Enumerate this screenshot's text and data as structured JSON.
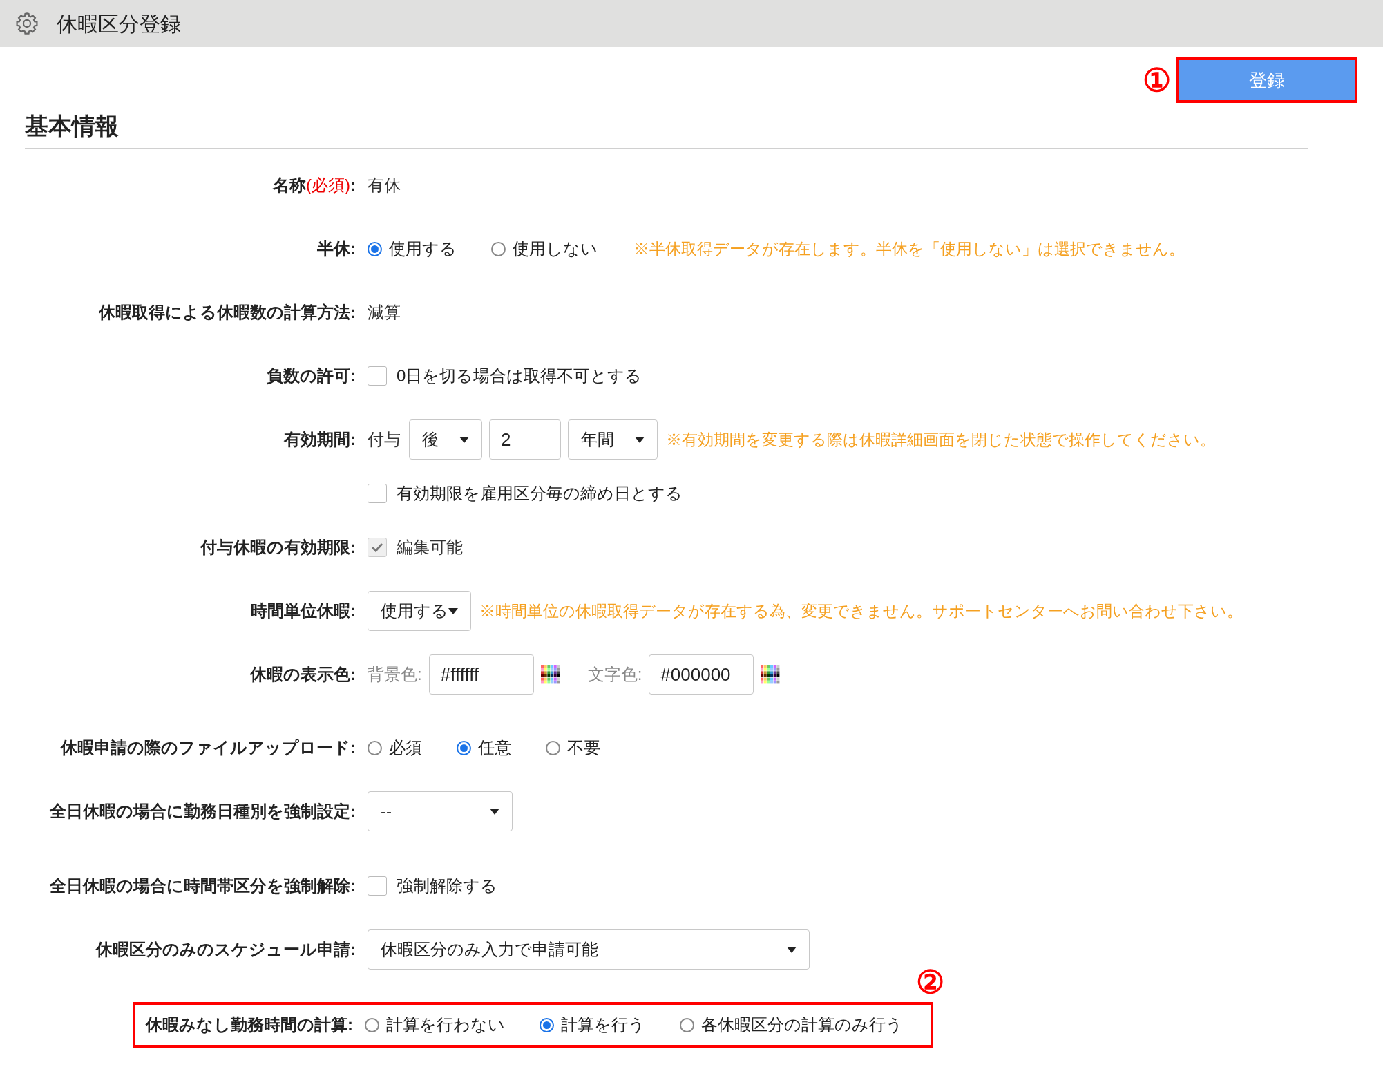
{
  "header": {
    "title": "休暇区分登録"
  },
  "register_button": {
    "label": "登録",
    "annotation": "①"
  },
  "section": {
    "title": "基本情報"
  },
  "rows": [
    {
      "label": "名称",
      "required_note": "(必須)",
      "label_tail": ":",
      "items": [
        {
          "kind": "text",
          "text": "有休"
        }
      ]
    },
    {
      "label": "半休:",
      "items": [
        {
          "kind": "radio",
          "label": "使用する",
          "selected": true
        },
        {
          "kind": "radio",
          "label": "使用しない",
          "selected": false
        },
        {
          "kind": "note",
          "text": "※半休取得データが存在します。半休を「使用しない」は選択できません。"
        }
      ]
    },
    {
      "label": "休暇取得による休暇数の計算方法:",
      "items": [
        {
          "kind": "text",
          "text": "減算"
        }
      ]
    },
    {
      "label": "負数の許可:",
      "items": [
        {
          "kind": "checkbox",
          "label": "0日を切る場合は取得不可とする",
          "checked": false,
          "disabled": false
        }
      ]
    },
    {
      "label": "有効期間:",
      "items": [
        {
          "kind": "text",
          "text": "付与"
        },
        {
          "kind": "select",
          "value": "後"
        },
        {
          "kind": "input",
          "value": "2"
        },
        {
          "kind": "select",
          "value": "年間"
        },
        {
          "kind": "note",
          "text": "※有効期間を変更する際は休暇詳細画面を閉じた状態で操作してください。"
        }
      ]
    },
    {
      "items": [
        {
          "kind": "checkbox",
          "label": "有効期限を雇用区分毎の締め日とする",
          "checked": false,
          "disabled": false
        }
      ]
    },
    {
      "label": "付与休暇の有効期限:",
      "items": [
        {
          "kind": "checkbox",
          "label": "編集可能",
          "checked": true,
          "disabled": true
        }
      ]
    },
    {
      "label": "時間単位休暇:",
      "items": [
        {
          "kind": "select",
          "value": "使用する"
        },
        {
          "kind": "note",
          "text": "※時間単位の休暇取得データが存在する為、変更できません。サポートセンターへお問い合わせ下さい。"
        }
      ]
    },
    {
      "label": "休暇の表示色:",
      "items": [
        {
          "kind": "color",
          "caption": "背景色:",
          "value": "#ffffff"
        },
        {
          "kind": "color",
          "caption": "文字色:",
          "value": "#000000"
        }
      ]
    },
    {
      "label": "休暇申請の際のファイルアップロード:",
      "items": [
        {
          "kind": "radio",
          "label": "必須",
          "selected": false
        },
        {
          "kind": "radio",
          "label": "任意",
          "selected": true
        },
        {
          "kind": "radio",
          "label": "不要",
          "selected": false
        }
      ]
    },
    {
      "label": "全日休暇の場合に勤務日種別を強制設定:",
      "items": [
        {
          "kind": "select",
          "value": "--"
        }
      ]
    },
    {
      "label": "全日休暇の場合に時間帯区分を強制解除:",
      "items": [
        {
          "kind": "checkbox",
          "label": "強制解除する",
          "checked": false,
          "disabled": false
        }
      ]
    },
    {
      "label": "休暇区分のみのスケジュール申請:",
      "items": [
        {
          "kind": "select",
          "value": "休暇区分のみ入力で申請可能"
        }
      ]
    },
    {
      "label": "休暇みなし勤務時間の計算:",
      "highlighted": true,
      "annotation": "②",
      "items": [
        {
          "kind": "radio",
          "label": "計算を行わない",
          "selected": false
        },
        {
          "kind": "radio",
          "label": "計算を行う",
          "selected": true
        },
        {
          "kind": "radio",
          "label": "各休暇区分の計算のみ行う",
          "selected": false
        }
      ]
    }
  ]
}
